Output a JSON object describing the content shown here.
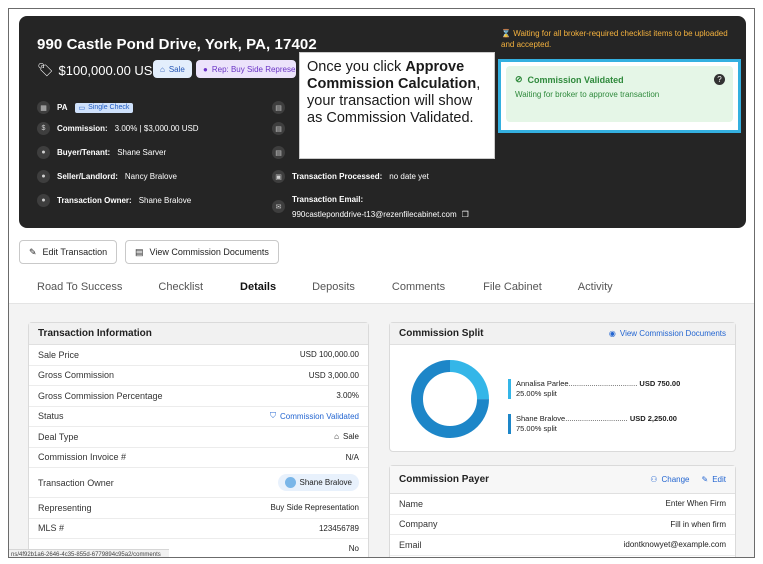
{
  "header": {
    "address": "990 Castle Pond Drive, York, PA, 17402",
    "price": "$100,000.00 USD",
    "sale_badge": "Sale",
    "rep_badge": "Rep: Buy Side Representation",
    "warning": "Waiting for all broker-required checklist items to be uploaded and accepted.",
    "state": "PA",
    "check_chip": "Single Check",
    "commission_label": "Commission:",
    "commission_value": "3.00% | $3,000.00 USD",
    "buyer_label": "Buyer/Tenant:",
    "buyer_value": "Shane Sarver",
    "seller_label": "Seller/Landlord:",
    "seller_value": "Nancy Bralove",
    "owner_label": "Transaction Owner:",
    "owner_value": "Shane Bralove",
    "processed_label": "Transaction Processed:",
    "processed_value": "no date yet",
    "email_label": "Transaction Email:",
    "email_value": "990castleponddrive-t13@rezenfilecabinet.com"
  },
  "callout": {
    "text_before": "Once you click ",
    "bold": "Approve Commission Calculation",
    "text_after": ", your transaction will show as Commission Validated."
  },
  "validated": {
    "title": "Commission Validated",
    "subtitle": "Waiting for broker to approve transaction"
  },
  "actions": {
    "edit": "Edit Transaction",
    "view_docs": "View Commission Documents"
  },
  "tabs": [
    "Road To Success",
    "Checklist",
    "Details",
    "Deposits",
    "Comments",
    "File Cabinet",
    "Activity"
  ],
  "active_tab": "Details",
  "info": {
    "title": "Transaction Information",
    "rows": [
      {
        "label": "Sale Price",
        "value": "USD 100,000.00"
      },
      {
        "label": "Gross Commission",
        "value": "USD 3,000.00"
      },
      {
        "label": "Gross Commission Percentage",
        "value": "3.00%"
      },
      {
        "label": "Status",
        "value": "Commission Validated"
      },
      {
        "label": "Deal Type",
        "value": "Sale"
      },
      {
        "label": "Commission Invoice #",
        "value": "N/A"
      },
      {
        "label": "Transaction Owner",
        "value": "Shane Bralove"
      },
      {
        "label": "Representing",
        "value": "Buy Side Representation"
      },
      {
        "label": "MLS #",
        "value": "123456789"
      },
      {
        "label": "",
        "value": "No"
      }
    ]
  },
  "split": {
    "title": "Commission Split",
    "link": "View Commission Documents",
    "entries": [
      {
        "name": "Annalisa Parlee",
        "amount": "USD 750.00",
        "pct": "25.00% split",
        "fraction": 0.25,
        "color": "#34b6e8"
      },
      {
        "name": "Shane Bralove",
        "amount": "USD 2,250.00",
        "pct": "75.00% split",
        "fraction": 0.75,
        "color": "#1d86c8"
      }
    ]
  },
  "payer": {
    "title": "Commission Payer",
    "change": "Change",
    "edit": "Edit",
    "rows": [
      {
        "label": "Name",
        "value": "Enter When Firm"
      },
      {
        "label": "Company",
        "value": "Fill in when firm"
      },
      {
        "label": "Email",
        "value": "idontknowyet@example.com"
      }
    ]
  },
  "status_url": "ns/4f92b1a6-2646-4c35-855d-6779894c95a2/comments"
}
